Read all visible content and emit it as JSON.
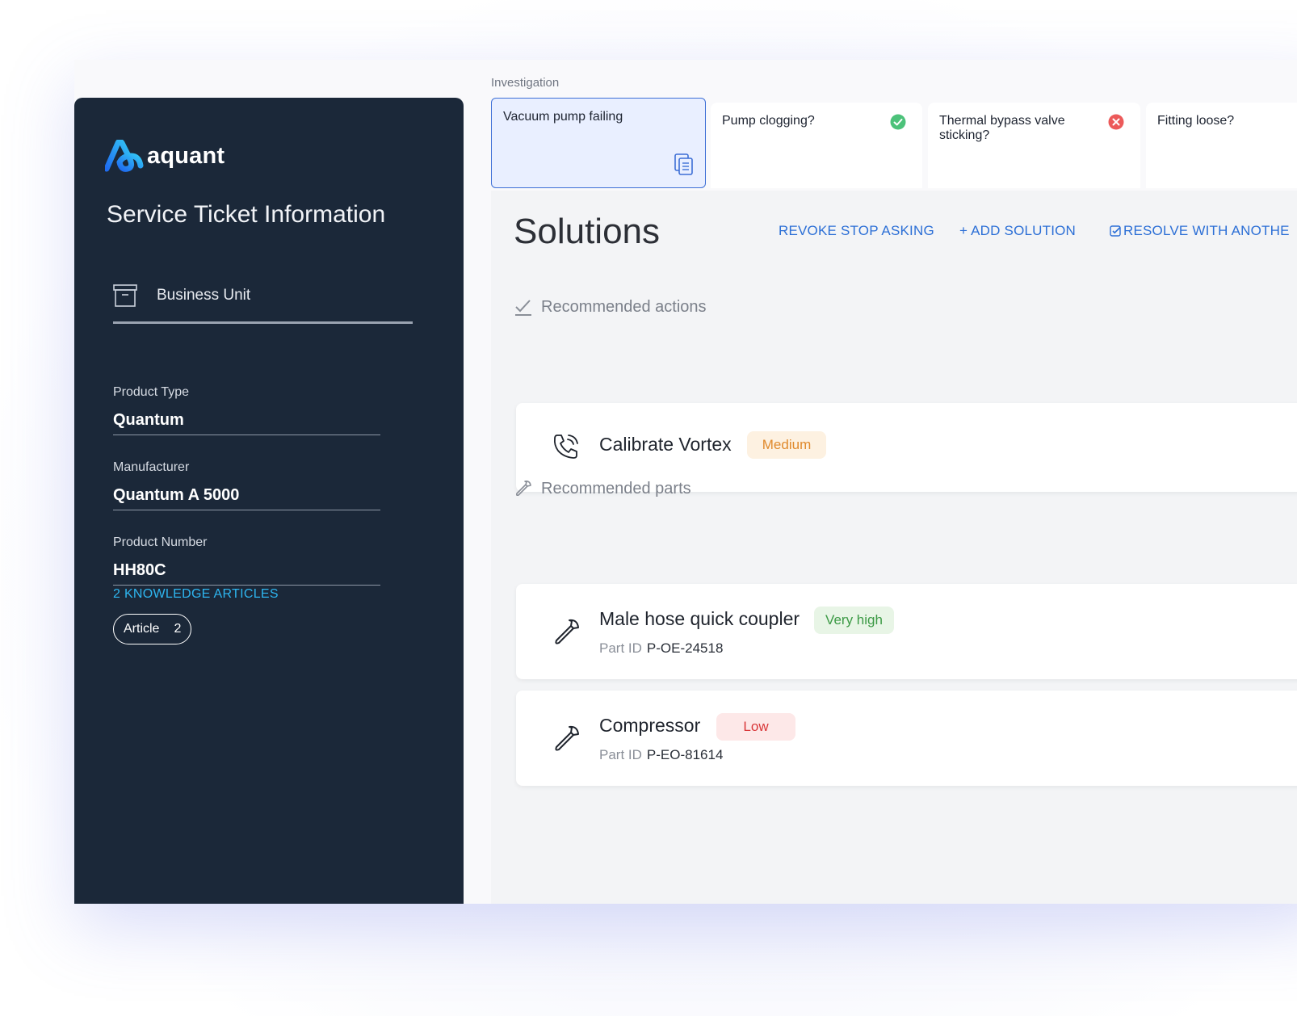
{
  "app": {
    "logo_text": "aquant",
    "colors": {
      "sidebar_bg": "#1b2839",
      "accent": "#2c6fd6",
      "link": "#2eb6f0"
    }
  },
  "sidebar": {
    "title": "Service Ticket Information",
    "business_unit": {
      "label": "Business Unit",
      "icon": "archive-box-icon"
    },
    "fields": [
      {
        "label": "Product Type",
        "value": "Quantum"
      },
      {
        "label": "Manufacturer",
        "value": "Quantum A 5000"
      },
      {
        "label": "Product Number",
        "value": "HH80C"
      }
    ],
    "knowledge_link": "2 KNOWLEDGE ARTICLES",
    "article_chip": {
      "label": "Article",
      "count": "2"
    }
  },
  "investigation": {
    "label": "Investigation",
    "tabs": [
      {
        "label": "Vacuum pump failing",
        "status": "active",
        "icon": "copy-icon"
      },
      {
        "label": "Pump clogging?",
        "status": "confirmed",
        "icon": "check-circle-icon"
      },
      {
        "label": "Thermal bypass valve sticking?",
        "status": "rejected",
        "icon": "x-circle-icon"
      },
      {
        "label": "Fitting loose?",
        "status": "none"
      }
    ]
  },
  "solutions": {
    "title": "Solutions",
    "actions": {
      "revoke": "REVOKE STOP ASKING",
      "add": "+ ADD SOLUTION",
      "resolve": "RESOLVE WITH ANOTHE"
    },
    "recommended_actions": {
      "heading": "Recommended actions",
      "items": [
        {
          "name": "Calibrate Vortex",
          "priority": "Medium",
          "icon": "phone-call-icon"
        }
      ]
    },
    "recommended_parts": {
      "heading": "Recommended parts",
      "part_id_label": "Part ID",
      "items": [
        {
          "name": "Male hose quick coupler",
          "priority": "Very high",
          "part_id": "P-OE-24518",
          "icon": "wrench-icon"
        },
        {
          "name": "Compressor",
          "priority": "Low",
          "part_id": "P-EO-81614",
          "icon": "wrench-icon"
        }
      ]
    }
  }
}
